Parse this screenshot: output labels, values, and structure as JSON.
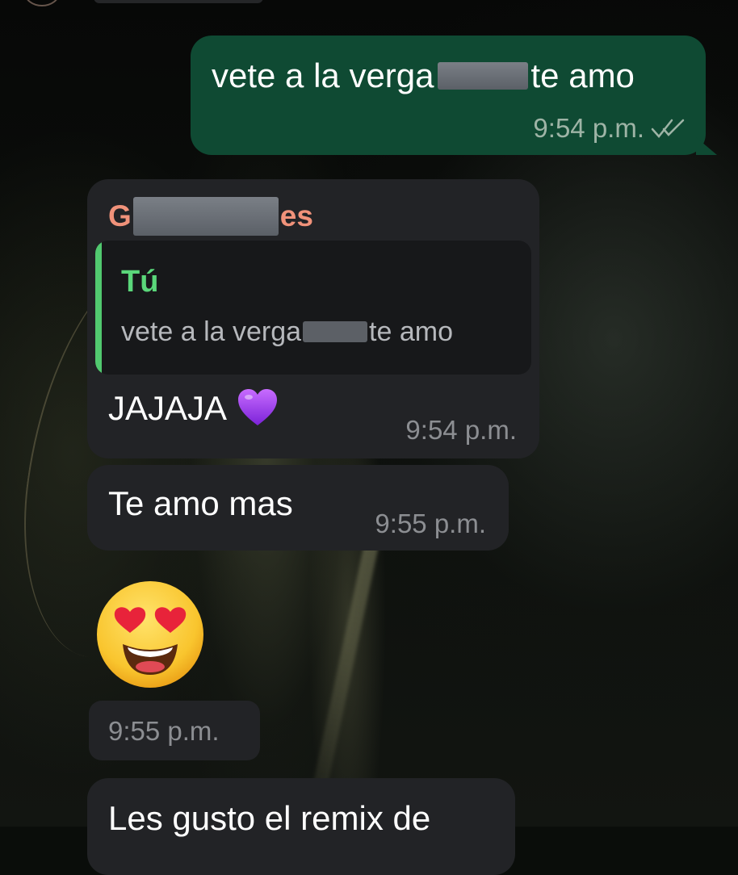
{
  "messages": {
    "outgoing": {
      "text_before": "vete a la verga",
      "text_after": "te amo",
      "time": "9:54 p.m.",
      "status_icon": "double-check-icon",
      "bubble_color": "#0f4a33"
    },
    "reply": {
      "sender_prefix": "G",
      "sender_suffix": "es",
      "sender_color": "#f0927a",
      "quoted_author": "Tú",
      "quoted_text_before": "vete a la verga",
      "quoted_text_after": "te amo",
      "text": "JAJAJA",
      "emoji": "purple-heart-icon",
      "time": "9:54 p.m."
    },
    "message2": {
      "text": "Te amo mas",
      "time": "9:55 p.m."
    },
    "emoji_message": {
      "emoji": "heart-eyes-emoji-icon",
      "time": "9:55 p.m."
    },
    "message3": {
      "text": "Les gusto el remix de"
    }
  },
  "colors": {
    "incoming_bubble": "#222326",
    "quote_accent": "#51c96f"
  }
}
